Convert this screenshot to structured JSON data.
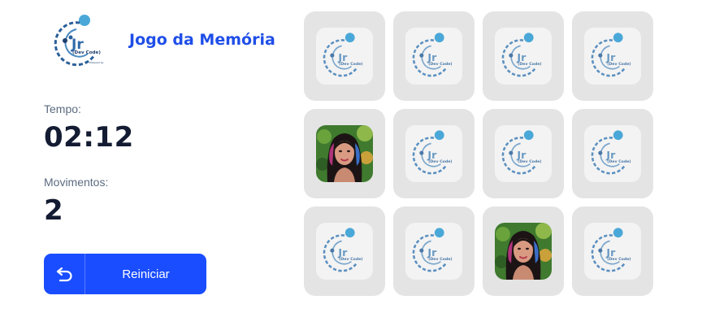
{
  "app": {
    "title": "Jogo da Memória",
    "logo": {
      "main": "Jr",
      "sub": "(Dev Code)",
      "tagline": "Powered by"
    }
  },
  "stats": {
    "time_label": "Tempo:",
    "time_value": "02:12",
    "moves_label": "Movimentos:",
    "moves_value": "2"
  },
  "restart": {
    "label": "Reiniciar",
    "icon": "undo-icon"
  },
  "colors": {
    "accent": "#1a4dff",
    "title": "#1f4ee8",
    "card_bg": "#e4e4e4",
    "logo_dot": "#4aa8d8"
  },
  "board": {
    "columns": 4,
    "cards": [
      {
        "state": "hidden"
      },
      {
        "state": "hidden"
      },
      {
        "state": "hidden"
      },
      {
        "state": "hidden"
      },
      {
        "state": "revealed",
        "image": "portrait"
      },
      {
        "state": "hidden"
      },
      {
        "state": "hidden"
      },
      {
        "state": "hidden"
      },
      {
        "state": "hidden"
      },
      {
        "state": "hidden"
      },
      {
        "state": "revealed",
        "image": "portrait"
      },
      {
        "state": "hidden"
      }
    ]
  }
}
